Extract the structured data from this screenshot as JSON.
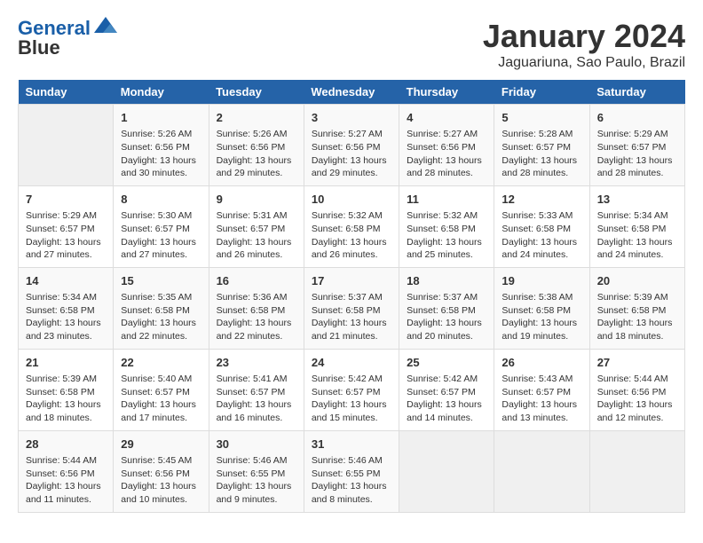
{
  "header": {
    "logo_line1": "General",
    "logo_line2": "Blue",
    "main_title": "January 2024",
    "subtitle": "Jaguariuna, Sao Paulo, Brazil"
  },
  "days_of_week": [
    "Sunday",
    "Monday",
    "Tuesday",
    "Wednesday",
    "Thursday",
    "Friday",
    "Saturday"
  ],
  "weeks": [
    [
      {
        "day": "",
        "info": ""
      },
      {
        "day": "1",
        "info": "Sunrise: 5:26 AM\nSunset: 6:56 PM\nDaylight: 13 hours\nand 30 minutes."
      },
      {
        "day": "2",
        "info": "Sunrise: 5:26 AM\nSunset: 6:56 PM\nDaylight: 13 hours\nand 29 minutes."
      },
      {
        "day": "3",
        "info": "Sunrise: 5:27 AM\nSunset: 6:56 PM\nDaylight: 13 hours\nand 29 minutes."
      },
      {
        "day": "4",
        "info": "Sunrise: 5:27 AM\nSunset: 6:56 PM\nDaylight: 13 hours\nand 28 minutes."
      },
      {
        "day": "5",
        "info": "Sunrise: 5:28 AM\nSunset: 6:57 PM\nDaylight: 13 hours\nand 28 minutes."
      },
      {
        "day": "6",
        "info": "Sunrise: 5:29 AM\nSunset: 6:57 PM\nDaylight: 13 hours\nand 28 minutes."
      }
    ],
    [
      {
        "day": "7",
        "info": "Sunrise: 5:29 AM\nSunset: 6:57 PM\nDaylight: 13 hours\nand 27 minutes."
      },
      {
        "day": "8",
        "info": "Sunrise: 5:30 AM\nSunset: 6:57 PM\nDaylight: 13 hours\nand 27 minutes."
      },
      {
        "day": "9",
        "info": "Sunrise: 5:31 AM\nSunset: 6:57 PM\nDaylight: 13 hours\nand 26 minutes."
      },
      {
        "day": "10",
        "info": "Sunrise: 5:32 AM\nSunset: 6:58 PM\nDaylight: 13 hours\nand 26 minutes."
      },
      {
        "day": "11",
        "info": "Sunrise: 5:32 AM\nSunset: 6:58 PM\nDaylight: 13 hours\nand 25 minutes."
      },
      {
        "day": "12",
        "info": "Sunrise: 5:33 AM\nSunset: 6:58 PM\nDaylight: 13 hours\nand 24 minutes."
      },
      {
        "day": "13",
        "info": "Sunrise: 5:34 AM\nSunset: 6:58 PM\nDaylight: 13 hours\nand 24 minutes."
      }
    ],
    [
      {
        "day": "14",
        "info": "Sunrise: 5:34 AM\nSunset: 6:58 PM\nDaylight: 13 hours\nand 23 minutes."
      },
      {
        "day": "15",
        "info": "Sunrise: 5:35 AM\nSunset: 6:58 PM\nDaylight: 13 hours\nand 22 minutes."
      },
      {
        "day": "16",
        "info": "Sunrise: 5:36 AM\nSunset: 6:58 PM\nDaylight: 13 hours\nand 22 minutes."
      },
      {
        "day": "17",
        "info": "Sunrise: 5:37 AM\nSunset: 6:58 PM\nDaylight: 13 hours\nand 21 minutes."
      },
      {
        "day": "18",
        "info": "Sunrise: 5:37 AM\nSunset: 6:58 PM\nDaylight: 13 hours\nand 20 minutes."
      },
      {
        "day": "19",
        "info": "Sunrise: 5:38 AM\nSunset: 6:58 PM\nDaylight: 13 hours\nand 19 minutes."
      },
      {
        "day": "20",
        "info": "Sunrise: 5:39 AM\nSunset: 6:58 PM\nDaylight: 13 hours\nand 18 minutes."
      }
    ],
    [
      {
        "day": "21",
        "info": "Sunrise: 5:39 AM\nSunset: 6:58 PM\nDaylight: 13 hours\nand 18 minutes."
      },
      {
        "day": "22",
        "info": "Sunrise: 5:40 AM\nSunset: 6:57 PM\nDaylight: 13 hours\nand 17 minutes."
      },
      {
        "day": "23",
        "info": "Sunrise: 5:41 AM\nSunset: 6:57 PM\nDaylight: 13 hours\nand 16 minutes."
      },
      {
        "day": "24",
        "info": "Sunrise: 5:42 AM\nSunset: 6:57 PM\nDaylight: 13 hours\nand 15 minutes."
      },
      {
        "day": "25",
        "info": "Sunrise: 5:42 AM\nSunset: 6:57 PM\nDaylight: 13 hours\nand 14 minutes."
      },
      {
        "day": "26",
        "info": "Sunrise: 5:43 AM\nSunset: 6:57 PM\nDaylight: 13 hours\nand 13 minutes."
      },
      {
        "day": "27",
        "info": "Sunrise: 5:44 AM\nSunset: 6:56 PM\nDaylight: 13 hours\nand 12 minutes."
      }
    ],
    [
      {
        "day": "28",
        "info": "Sunrise: 5:44 AM\nSunset: 6:56 PM\nDaylight: 13 hours\nand 11 minutes."
      },
      {
        "day": "29",
        "info": "Sunrise: 5:45 AM\nSunset: 6:56 PM\nDaylight: 13 hours\nand 10 minutes."
      },
      {
        "day": "30",
        "info": "Sunrise: 5:46 AM\nSunset: 6:55 PM\nDaylight: 13 hours\nand 9 minutes."
      },
      {
        "day": "31",
        "info": "Sunrise: 5:46 AM\nSunset: 6:55 PM\nDaylight: 13 hours\nand 8 minutes."
      },
      {
        "day": "",
        "info": ""
      },
      {
        "day": "",
        "info": ""
      },
      {
        "day": "",
        "info": ""
      }
    ]
  ]
}
